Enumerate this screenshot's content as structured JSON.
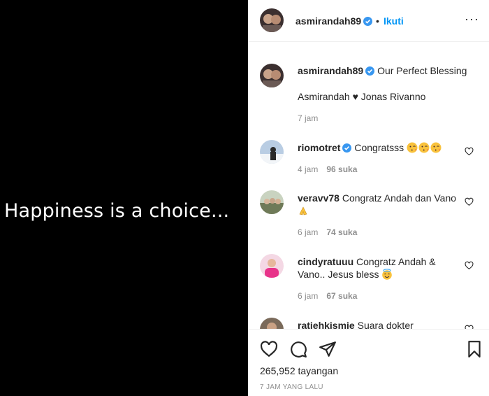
{
  "media": {
    "text": "Happiness is a choice..."
  },
  "header": {
    "username": "asmirandah89",
    "dot": "•",
    "follow_label": "Ikuti",
    "more_label": "···"
  },
  "caption": {
    "username": "asmirandah89",
    "text": "Our Perfect Blessing",
    "line2": "Asmirandah ♥ Jonas Rivanno",
    "time": "7 jam"
  },
  "comments": [
    {
      "username": "riomotret",
      "text": "Congratsss",
      "time": "4 jam",
      "likes": "96 suka"
    },
    {
      "username": "veravv78",
      "text": "Congratz Andah dan Vano",
      "time": "6 jam",
      "likes": "74 suka"
    },
    {
      "username": "cindyratuuu",
      "text": "Congratz Andah & Vano.. Jesus bless",
      "time": "6 jam",
      "likes": "67 suka"
    },
    {
      "username": "ratiehkismie",
      "text": "Suara dokter"
    }
  ],
  "actions": {
    "views": "265,952 tayangan",
    "ago": "7 JAM YANG LALU"
  },
  "colors": {
    "link": "#0095f6",
    "muted": "#8e8e8e",
    "verified": "#3897f0"
  }
}
